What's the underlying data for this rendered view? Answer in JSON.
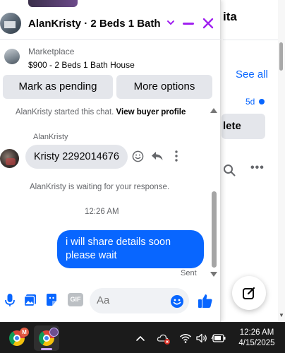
{
  "background_page": {
    "title_fragment": "ita",
    "see_all": "See all",
    "age": "5d",
    "delete_fragment": "lete",
    "more_dots": "•••"
  },
  "chat": {
    "title": "AlanKristy · 2 Beds 1 Bath …",
    "listing": {
      "source": "Marketplace",
      "name": "$900 - 2 Beds 1 Bath House"
    },
    "buttons": {
      "mark_pending": "Mark as pending",
      "more_options": "More options"
    },
    "messages": {
      "started_prefix": "AlanKristy started this chat.",
      "view_profile": "View buyer profile",
      "sender_name": "AlanKristy",
      "incoming_text": "Kristy 2292014676",
      "waiting": "AlanKristy is waiting for your response.",
      "timestamp": "12:26 AM",
      "outgoing_text": "i will share details soon please wait",
      "sent_status": "Sent"
    },
    "composer": {
      "placeholder": "Aa",
      "gif_label": "GIF"
    }
  },
  "taskbar": {
    "app1_badge": "M",
    "time": "12:26 AM",
    "date": "4/15/2025"
  },
  "colors": {
    "brand_blue": "#0866ff",
    "header_accent": "#a020f0",
    "taskbar_bg": "#1b1b1b"
  }
}
